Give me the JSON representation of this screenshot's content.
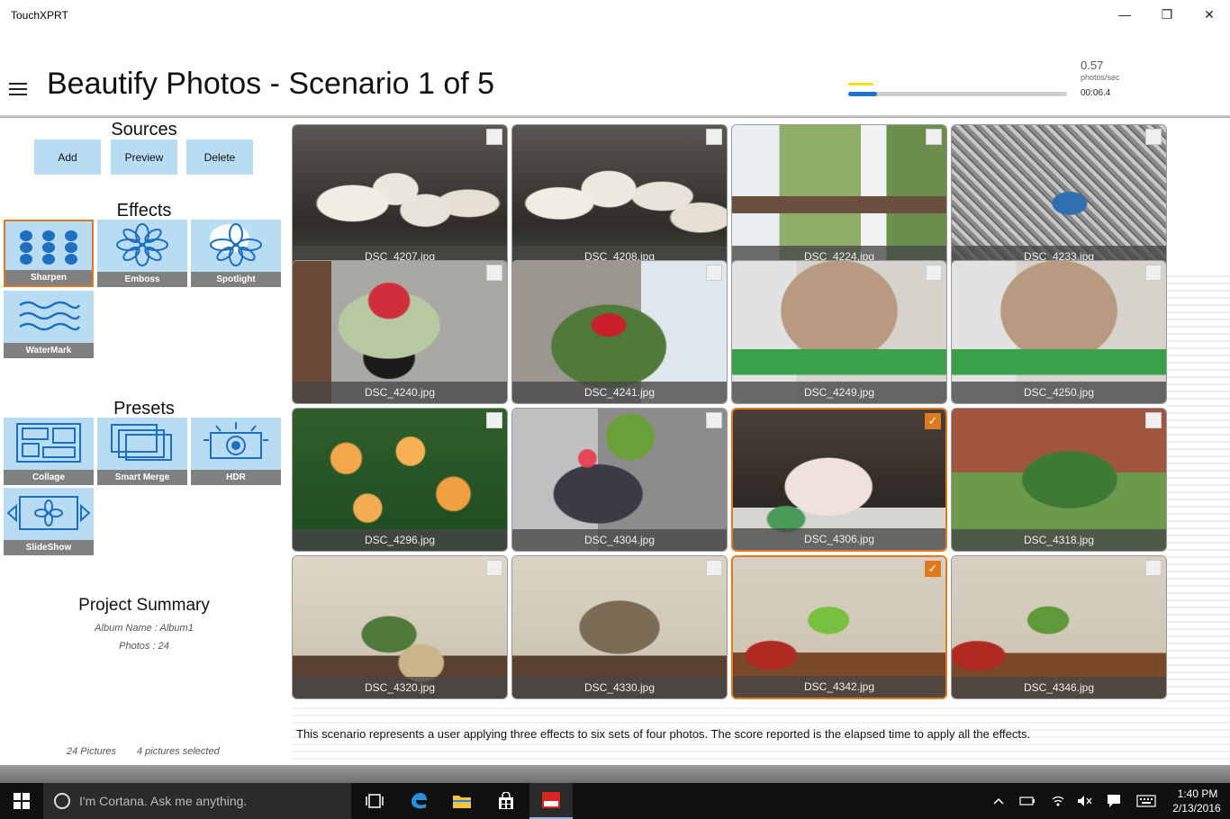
{
  "window": {
    "title": "TouchXPRT",
    "minimize": "—",
    "maximize": "❐",
    "close": "✕"
  },
  "header": {
    "title": "Beautify Photos - Scenario 1 of 5",
    "rate_value": "0.57",
    "rate_unit": "photos/sec",
    "elapsed": "00:06.4",
    "progress_fraction": 0.13
  },
  "sources": {
    "title": "Sources",
    "buttons": [
      "Add",
      "Preview",
      "Delete"
    ]
  },
  "effects": {
    "title": "Effects",
    "items": [
      {
        "label": "Sharpen",
        "icon": "sharpen-icon",
        "selected": true
      },
      {
        "label": "Emboss",
        "icon": "emboss-icon",
        "selected": false
      },
      {
        "label": "Spotlight",
        "icon": "spotlight-icon",
        "selected": false
      },
      {
        "label": "WaterMark",
        "icon": "watermark-icon",
        "selected": false
      }
    ]
  },
  "presets": {
    "title": "Presets",
    "items": [
      {
        "label": "Collage",
        "icon": "collage-icon"
      },
      {
        "label": "Smart Merge",
        "icon": "smart-merge-icon"
      },
      {
        "label": "HDR",
        "icon": "hdr-icon"
      },
      {
        "label": "SlideShow",
        "icon": "slideshow-icon"
      }
    ]
  },
  "summary": {
    "title": "Project Summary",
    "album": "Album Name : Album1",
    "photos": "Photos : 24"
  },
  "footer": {
    "pictures": "24 Pictures",
    "selected": "4 pictures selected"
  },
  "photos": [
    {
      "name": "DSC_4207.jpg",
      "checked": false
    },
    {
      "name": "DSC_4208.jpg",
      "checked": false
    },
    {
      "name": "DSC_4224.jpg",
      "checked": false
    },
    {
      "name": "DSC_4233.jpg",
      "checked": false
    },
    {
      "name": "DSC_4240.jpg",
      "checked": false
    },
    {
      "name": "DSC_4241.jpg",
      "checked": false
    },
    {
      "name": "DSC_4249.jpg",
      "checked": false
    },
    {
      "name": "DSC_4250.jpg",
      "checked": false
    },
    {
      "name": "DSC_4296.jpg",
      "checked": false
    },
    {
      "name": "DSC_4304.jpg",
      "checked": false
    },
    {
      "name": "DSC_4306.jpg",
      "checked": true
    },
    {
      "name": "DSC_4318.jpg",
      "checked": false
    },
    {
      "name": "DSC_4320.jpg",
      "checked": false
    },
    {
      "name": "DSC_4330.jpg",
      "checked": false
    },
    {
      "name": "DSC_4342.jpg",
      "checked": true
    },
    {
      "name": "DSC_4346.jpg",
      "checked": false
    }
  ],
  "description": "This scenario represents a user applying three effects to six sets of four photos. The score reported is the elapsed time to apply all the effects.",
  "taskbar": {
    "cortana_placeholder": "I'm Cortana. Ask me anything.",
    "time": "1:40 PM",
    "date": "2/13/2016"
  },
  "colors": {
    "accent_tile": "#b8dcf2",
    "selection": "#e07a20",
    "progress": "#1a73c9"
  }
}
